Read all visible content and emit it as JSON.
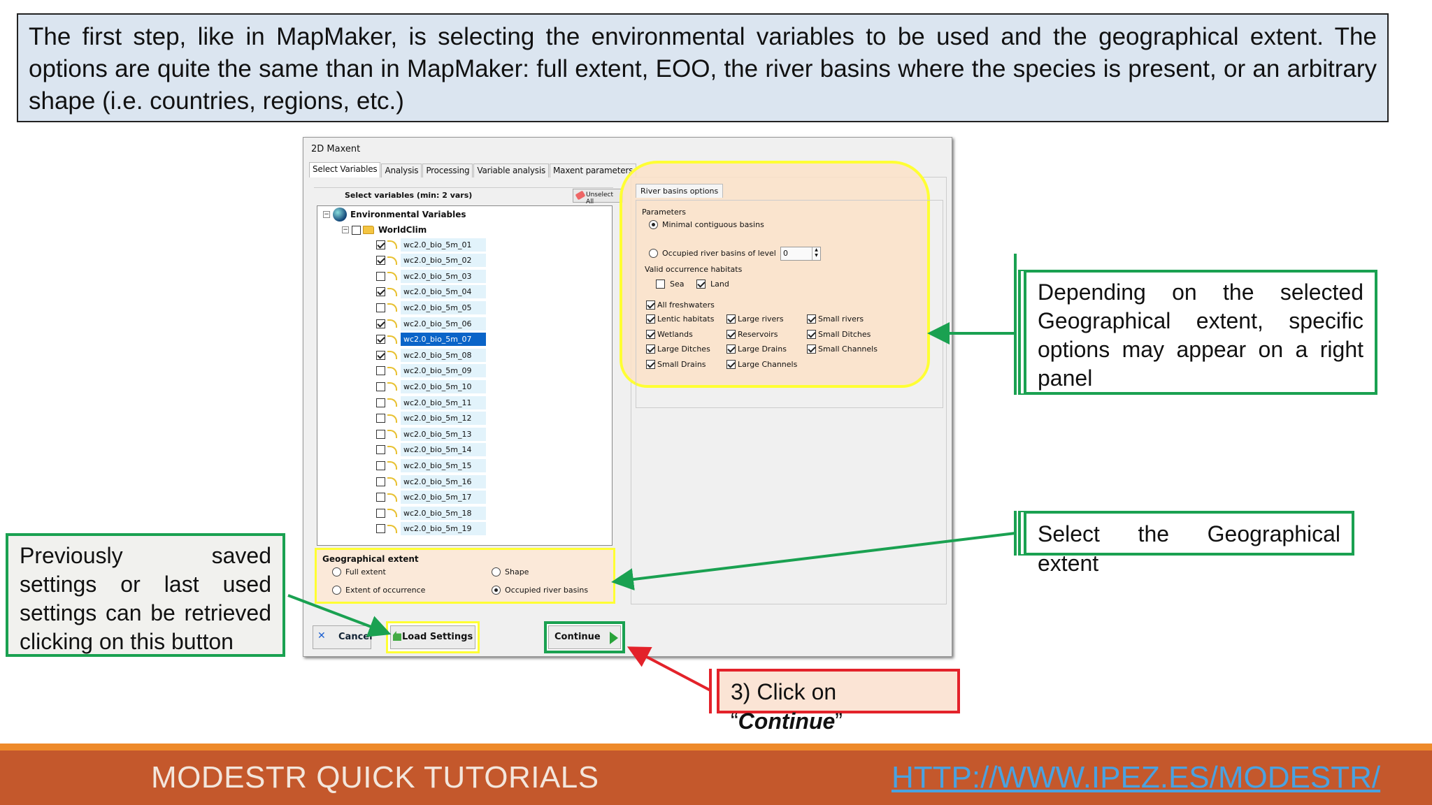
{
  "slide": {
    "top_note": "The first step, like in MapMaker, is selecting the environmental variables to be used and the geographical extent. The options are quite the same than in MapMaker: full extent, EOO, the river basins where the species is present, or an arbitrary shape (i.e. countries,  regions, etc.)",
    "right_note": "Depending on the selected Geographical extent, specific options may appear on a right panel",
    "extent_note": "Select the Geographical extent",
    "left_note": "Previously saved settings or last used settings can be retrieved clicking on this button",
    "continue_note": {
      "prefix": "3) Click on “",
      "emph": "Continue",
      "suffix": "”"
    },
    "footer_title": "MODESTR QUICK TUTORIALS",
    "footer_link": "HTTP://WWW.IPEZ.ES/MODESTR/",
    "colors": {
      "green": "#1aa151",
      "red": "#e3222a",
      "yellow": "#ffff33",
      "footer": "#c4582c",
      "stripe": "#ee8a2a",
      "note_bg": "#dbe5f0"
    }
  },
  "dialog": {
    "title": "2D Maxent",
    "tabs": [
      "Select Variables",
      "Analysis",
      "Processing",
      "Variable analysis",
      "Maxent parameters"
    ],
    "select_label": "Select variables (min: 2 vars)",
    "unselect_label": "Unselect All",
    "tree_root": "Environmental Variables",
    "tree_group": "WorldClim",
    "variables": [
      {
        "name": "wc2.0_bio_5m_01",
        "checked": true
      },
      {
        "name": "wc2.0_bio_5m_02",
        "checked": true
      },
      {
        "name": "wc2.0_bio_5m_03",
        "checked": false
      },
      {
        "name": "wc2.0_bio_5m_04",
        "checked": true
      },
      {
        "name": "wc2.0_bio_5m_05",
        "checked": false
      },
      {
        "name": "wc2.0_bio_5m_06",
        "checked": true
      },
      {
        "name": "wc2.0_bio_5m_07",
        "checked": true
      },
      {
        "name": "wc2.0_bio_5m_08",
        "checked": true
      },
      {
        "name": "wc2.0_bio_5m_09",
        "checked": false
      },
      {
        "name": "wc2.0_bio_5m_10",
        "checked": false
      },
      {
        "name": "wc2.0_bio_5m_11",
        "checked": false
      },
      {
        "name": "wc2.0_bio_5m_12",
        "checked": false
      },
      {
        "name": "wc2.0_bio_5m_13",
        "checked": false
      },
      {
        "name": "wc2.0_bio_5m_14",
        "checked": false
      },
      {
        "name": "wc2.0_bio_5m_15",
        "checked": false
      },
      {
        "name": "wc2.0_bio_5m_16",
        "checked": false
      },
      {
        "name": "wc2.0_bio_5m_17",
        "checked": false
      },
      {
        "name": "wc2.0_bio_5m_18",
        "checked": false
      },
      {
        "name": "wc2.0_bio_5m_19",
        "checked": false
      }
    ],
    "selected_variable": "wc2.0_bio_5m_07",
    "geo": {
      "title": "Geographical extent",
      "full_extent": "Full extent",
      "shape": "Shape",
      "eoo": "Extent of occurrence",
      "basins": "Occupied river basins",
      "selected": "Occupied river basins"
    },
    "buttons": {
      "cancel": "Cancel",
      "load": "Load Settings",
      "continue": "Continue"
    },
    "river": {
      "tab": "River basins options",
      "parameters": "Parameters",
      "minimal": "Minimal contiguous basins",
      "occupied_level": "Occupied river basins of level",
      "level_value": "0",
      "habitats_label": "Valid occurrence habitats",
      "sea": "Sea",
      "land": "Land",
      "all_fresh": "All freshwaters",
      "habitats": [
        [
          "Lentic habitats",
          "Large rivers",
          "Small rivers"
        ],
        [
          "Wetlands",
          "Reservoirs",
          "Small Ditches"
        ],
        [
          "Large Ditches",
          "Large Drains",
          "Small Channels"
        ],
        [
          "Small Drains",
          "Large Channels",
          ""
        ]
      ]
    }
  }
}
